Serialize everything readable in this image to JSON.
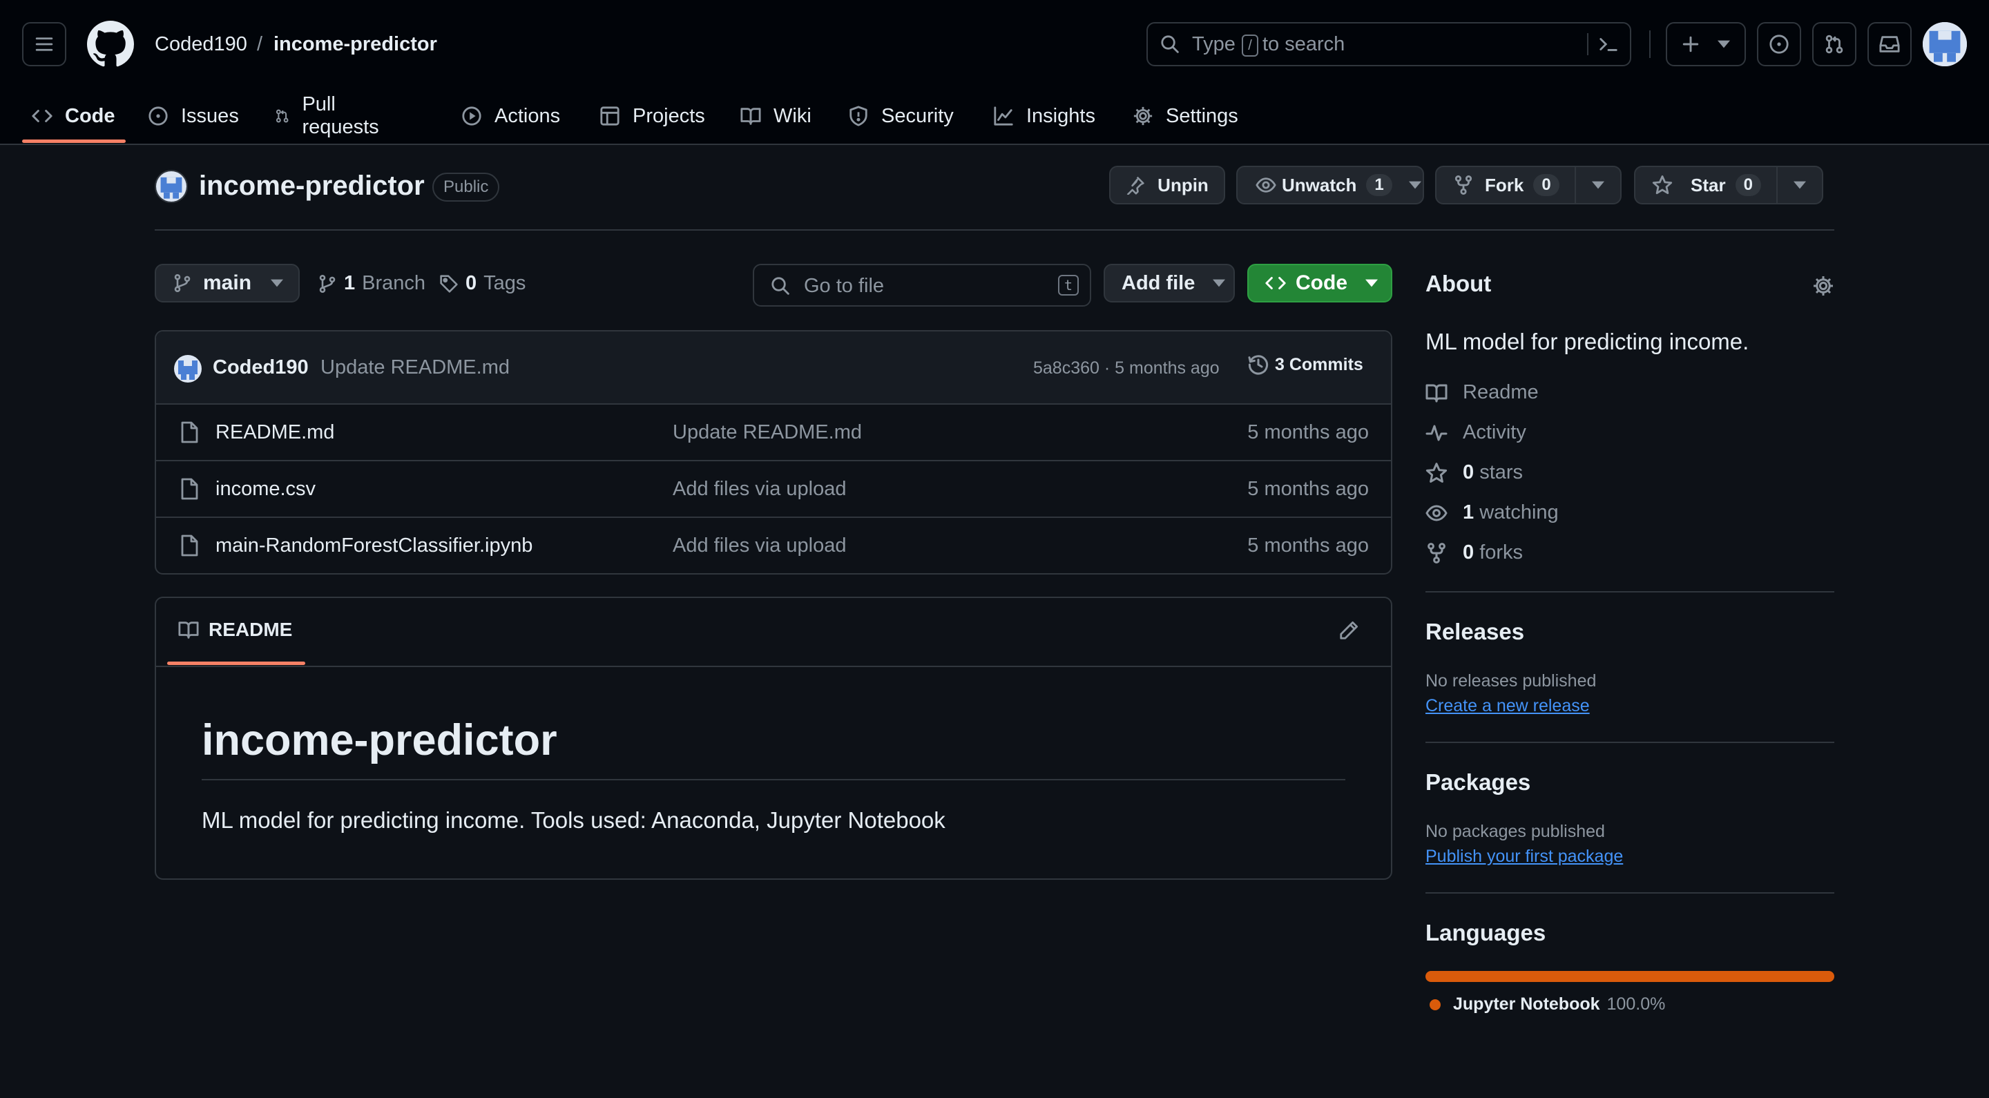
{
  "header": {
    "owner": "Coded190",
    "separator": "/",
    "repo": "income-predictor",
    "search": {
      "prefix": "Type",
      "key": "/",
      "suffix": "to search"
    }
  },
  "tabs": [
    {
      "label": "Code",
      "icon": "code-icon"
    },
    {
      "label": "Issues",
      "icon": "issue-icon"
    },
    {
      "label": "Pull requests",
      "icon": "pull-request-icon"
    },
    {
      "label": "Actions",
      "icon": "play-icon"
    },
    {
      "label": "Projects",
      "icon": "table-icon"
    },
    {
      "label": "Wiki",
      "icon": "book-icon"
    },
    {
      "label": "Security",
      "icon": "shield-icon"
    },
    {
      "label": "Insights",
      "icon": "graph-icon"
    },
    {
      "label": "Settings",
      "icon": "gear-icon"
    }
  ],
  "repo": {
    "name": "income-predictor",
    "visibility": "Public",
    "unpin": "Unpin",
    "unwatch": "Unwatch",
    "watch_count": "1",
    "fork": "Fork",
    "fork_count": "0",
    "star": "Star",
    "star_count": "0"
  },
  "toolbar": {
    "branch": "main",
    "branches_count": "1",
    "branches_label": "Branch",
    "tags_count": "0",
    "tags_label": "Tags",
    "goto_placeholder": "Go to file",
    "goto_key": "t",
    "add_file": "Add file",
    "code": "Code"
  },
  "commit": {
    "author": "Coded190",
    "message": "Update README.md",
    "hash_time": "5a8c360 · 5 months ago",
    "commits_label": "3 Commits"
  },
  "files": [
    {
      "name": "README.md",
      "message": "Update README.md",
      "time": "5 months ago"
    },
    {
      "name": "income.csv",
      "message": "Add files via upload",
      "time": "5 months ago"
    },
    {
      "name": "main-RandomForestClassifier.ipynb",
      "message": "Add files via upload",
      "time": "5 months ago"
    }
  ],
  "readme": {
    "tab": "README",
    "title": "income-predictor",
    "body": "ML model for predicting income. Tools used: Anaconda, Jupyter Notebook"
  },
  "about": {
    "heading": "About",
    "description": "ML model for predicting income.",
    "readme": "Readme",
    "activity": "Activity",
    "stars_count": "0",
    "stars_label": "stars",
    "watching_count": "1",
    "watching_label": "watching",
    "forks_count": "0",
    "forks_label": "forks"
  },
  "releases": {
    "heading": "Releases",
    "empty": "No releases published",
    "link": "Create a new release"
  },
  "packages": {
    "heading": "Packages",
    "empty": "No packages published",
    "link": "Publish your first package"
  },
  "languages": {
    "heading": "Languages",
    "items": [
      {
        "name": "Jupyter Notebook",
        "percent": "100.0%",
        "share": 1.0,
        "color": "#da5b0b"
      }
    ]
  },
  "colors": {
    "accent_green": "#238636",
    "tab_underline": "#f78166",
    "link": "#4493f8"
  }
}
